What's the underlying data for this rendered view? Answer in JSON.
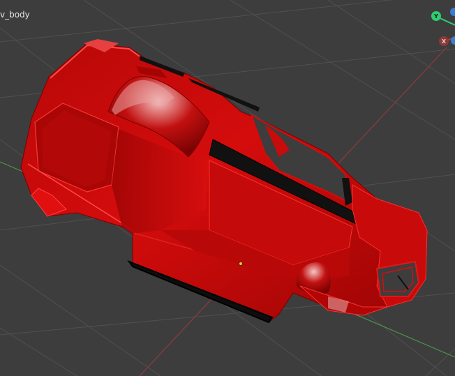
{
  "viewport": {
    "object_name": "v_body",
    "colors": {
      "background": "#3d3d3d",
      "grid": "#4f4f4f",
      "x_axis": "#8a3a3a",
      "y_axis": "#4f8a4f",
      "body_red": "#d10a0a",
      "body_dark": "#8a0000",
      "trim_black": "#0d0d0d",
      "origin": "#f0c020"
    }
  },
  "gizmo": {
    "y_label": "Y",
    "x_label": "X",
    "colors": {
      "y": "#2ecc71",
      "x": "#c0392b",
      "z": "#3a7bd5"
    }
  }
}
